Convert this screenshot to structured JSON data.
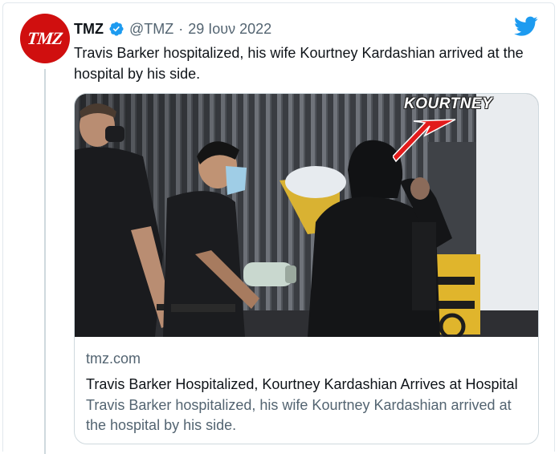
{
  "tweet": {
    "author_name": "TMZ",
    "handle": "@TMZ",
    "separator": "·",
    "date": "29 Ιουν 2022",
    "avatar_text": "TMZ",
    "text": "Travis Barker hospitalized, his wife Kourtney Kardashian arrived at the hospital by his side.",
    "verified": true
  },
  "card": {
    "image_label": "KOURTNEY",
    "domain": "tmz.com",
    "title": "Travis Barker Hospitalized, Kourtney Kardashian Arrives at Hospital",
    "description": "Travis Barker hospitalized, his wife Kourtney Kardashian arrived at the hospital by his side."
  },
  "icons": {
    "verified": "verified-badge-icon",
    "brand": "twitter-bird-icon"
  },
  "colors": {
    "brand_blue": "#1d9bf0",
    "avatar_red": "#d00f0f",
    "text_primary": "#0f1419",
    "text_secondary": "#536471",
    "arrow_red": "#e21b1b"
  }
}
